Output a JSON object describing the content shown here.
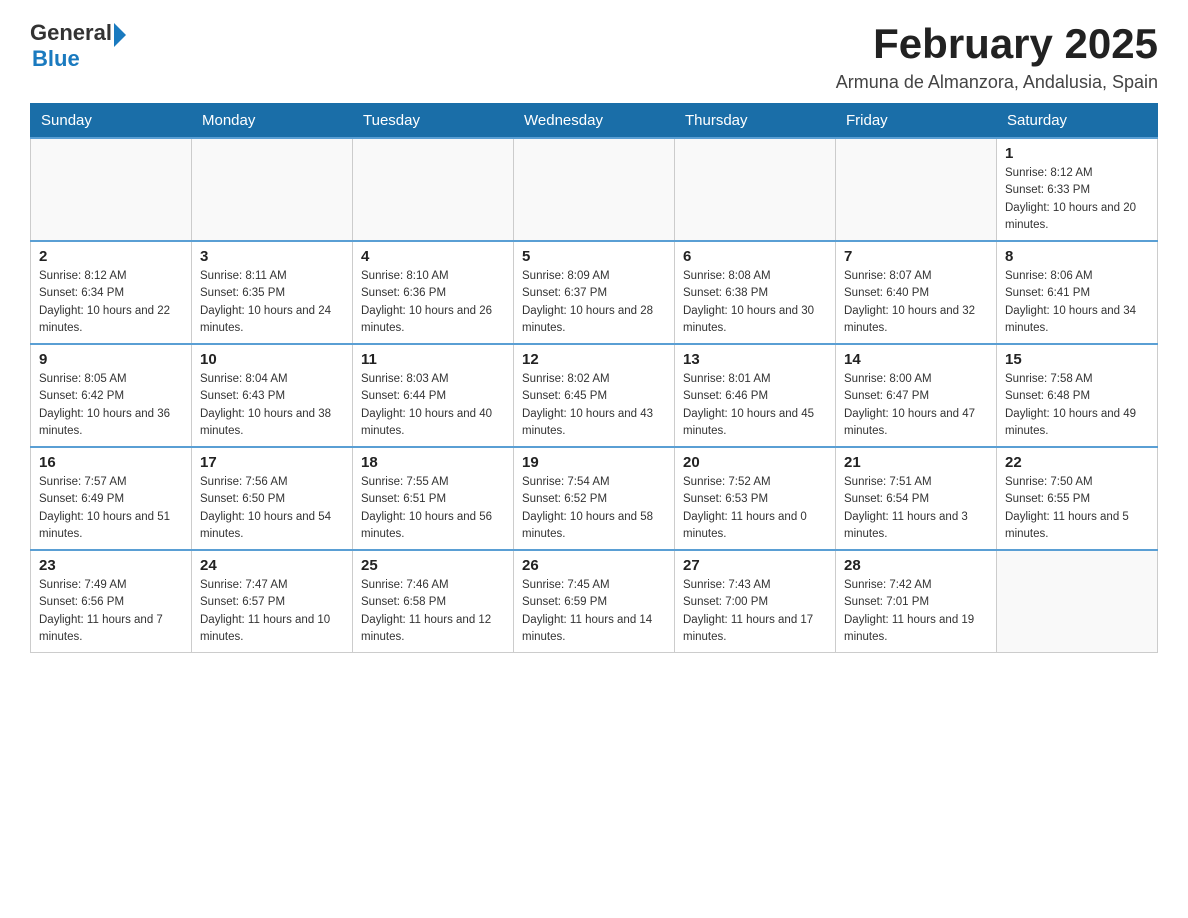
{
  "header": {
    "logo_general": "General",
    "logo_blue": "Blue",
    "title": "February 2025",
    "location": "Armuna de Almanzora, Andalusia, Spain"
  },
  "days_of_week": [
    "Sunday",
    "Monday",
    "Tuesday",
    "Wednesday",
    "Thursday",
    "Friday",
    "Saturday"
  ],
  "weeks": [
    [
      {
        "day": "",
        "sunrise": "",
        "sunset": "",
        "daylight": ""
      },
      {
        "day": "",
        "sunrise": "",
        "sunset": "",
        "daylight": ""
      },
      {
        "day": "",
        "sunrise": "",
        "sunset": "",
        "daylight": ""
      },
      {
        "day": "",
        "sunrise": "",
        "sunset": "",
        "daylight": ""
      },
      {
        "day": "",
        "sunrise": "",
        "sunset": "",
        "daylight": ""
      },
      {
        "day": "",
        "sunrise": "",
        "sunset": "",
        "daylight": ""
      },
      {
        "day": "1",
        "sunrise": "Sunrise: 8:12 AM",
        "sunset": "Sunset: 6:33 PM",
        "daylight": "Daylight: 10 hours and 20 minutes."
      }
    ],
    [
      {
        "day": "2",
        "sunrise": "Sunrise: 8:12 AM",
        "sunset": "Sunset: 6:34 PM",
        "daylight": "Daylight: 10 hours and 22 minutes."
      },
      {
        "day": "3",
        "sunrise": "Sunrise: 8:11 AM",
        "sunset": "Sunset: 6:35 PM",
        "daylight": "Daylight: 10 hours and 24 minutes."
      },
      {
        "day": "4",
        "sunrise": "Sunrise: 8:10 AM",
        "sunset": "Sunset: 6:36 PM",
        "daylight": "Daylight: 10 hours and 26 minutes."
      },
      {
        "day": "5",
        "sunrise": "Sunrise: 8:09 AM",
        "sunset": "Sunset: 6:37 PM",
        "daylight": "Daylight: 10 hours and 28 minutes."
      },
      {
        "day": "6",
        "sunrise": "Sunrise: 8:08 AM",
        "sunset": "Sunset: 6:38 PM",
        "daylight": "Daylight: 10 hours and 30 minutes."
      },
      {
        "day": "7",
        "sunrise": "Sunrise: 8:07 AM",
        "sunset": "Sunset: 6:40 PM",
        "daylight": "Daylight: 10 hours and 32 minutes."
      },
      {
        "day": "8",
        "sunrise": "Sunrise: 8:06 AM",
        "sunset": "Sunset: 6:41 PM",
        "daylight": "Daylight: 10 hours and 34 minutes."
      }
    ],
    [
      {
        "day": "9",
        "sunrise": "Sunrise: 8:05 AM",
        "sunset": "Sunset: 6:42 PM",
        "daylight": "Daylight: 10 hours and 36 minutes."
      },
      {
        "day": "10",
        "sunrise": "Sunrise: 8:04 AM",
        "sunset": "Sunset: 6:43 PM",
        "daylight": "Daylight: 10 hours and 38 minutes."
      },
      {
        "day": "11",
        "sunrise": "Sunrise: 8:03 AM",
        "sunset": "Sunset: 6:44 PM",
        "daylight": "Daylight: 10 hours and 40 minutes."
      },
      {
        "day": "12",
        "sunrise": "Sunrise: 8:02 AM",
        "sunset": "Sunset: 6:45 PM",
        "daylight": "Daylight: 10 hours and 43 minutes."
      },
      {
        "day": "13",
        "sunrise": "Sunrise: 8:01 AM",
        "sunset": "Sunset: 6:46 PM",
        "daylight": "Daylight: 10 hours and 45 minutes."
      },
      {
        "day": "14",
        "sunrise": "Sunrise: 8:00 AM",
        "sunset": "Sunset: 6:47 PM",
        "daylight": "Daylight: 10 hours and 47 minutes."
      },
      {
        "day": "15",
        "sunrise": "Sunrise: 7:58 AM",
        "sunset": "Sunset: 6:48 PM",
        "daylight": "Daylight: 10 hours and 49 minutes."
      }
    ],
    [
      {
        "day": "16",
        "sunrise": "Sunrise: 7:57 AM",
        "sunset": "Sunset: 6:49 PM",
        "daylight": "Daylight: 10 hours and 51 minutes."
      },
      {
        "day": "17",
        "sunrise": "Sunrise: 7:56 AM",
        "sunset": "Sunset: 6:50 PM",
        "daylight": "Daylight: 10 hours and 54 minutes."
      },
      {
        "day": "18",
        "sunrise": "Sunrise: 7:55 AM",
        "sunset": "Sunset: 6:51 PM",
        "daylight": "Daylight: 10 hours and 56 minutes."
      },
      {
        "day": "19",
        "sunrise": "Sunrise: 7:54 AM",
        "sunset": "Sunset: 6:52 PM",
        "daylight": "Daylight: 10 hours and 58 minutes."
      },
      {
        "day": "20",
        "sunrise": "Sunrise: 7:52 AM",
        "sunset": "Sunset: 6:53 PM",
        "daylight": "Daylight: 11 hours and 0 minutes."
      },
      {
        "day": "21",
        "sunrise": "Sunrise: 7:51 AM",
        "sunset": "Sunset: 6:54 PM",
        "daylight": "Daylight: 11 hours and 3 minutes."
      },
      {
        "day": "22",
        "sunrise": "Sunrise: 7:50 AM",
        "sunset": "Sunset: 6:55 PM",
        "daylight": "Daylight: 11 hours and 5 minutes."
      }
    ],
    [
      {
        "day": "23",
        "sunrise": "Sunrise: 7:49 AM",
        "sunset": "Sunset: 6:56 PM",
        "daylight": "Daylight: 11 hours and 7 minutes."
      },
      {
        "day": "24",
        "sunrise": "Sunrise: 7:47 AM",
        "sunset": "Sunset: 6:57 PM",
        "daylight": "Daylight: 11 hours and 10 minutes."
      },
      {
        "day": "25",
        "sunrise": "Sunrise: 7:46 AM",
        "sunset": "Sunset: 6:58 PM",
        "daylight": "Daylight: 11 hours and 12 minutes."
      },
      {
        "day": "26",
        "sunrise": "Sunrise: 7:45 AM",
        "sunset": "Sunset: 6:59 PM",
        "daylight": "Daylight: 11 hours and 14 minutes."
      },
      {
        "day": "27",
        "sunrise": "Sunrise: 7:43 AM",
        "sunset": "Sunset: 7:00 PM",
        "daylight": "Daylight: 11 hours and 17 minutes."
      },
      {
        "day": "28",
        "sunrise": "Sunrise: 7:42 AM",
        "sunset": "Sunset: 7:01 PM",
        "daylight": "Daylight: 11 hours and 19 minutes."
      },
      {
        "day": "",
        "sunrise": "",
        "sunset": "",
        "daylight": ""
      }
    ]
  ]
}
